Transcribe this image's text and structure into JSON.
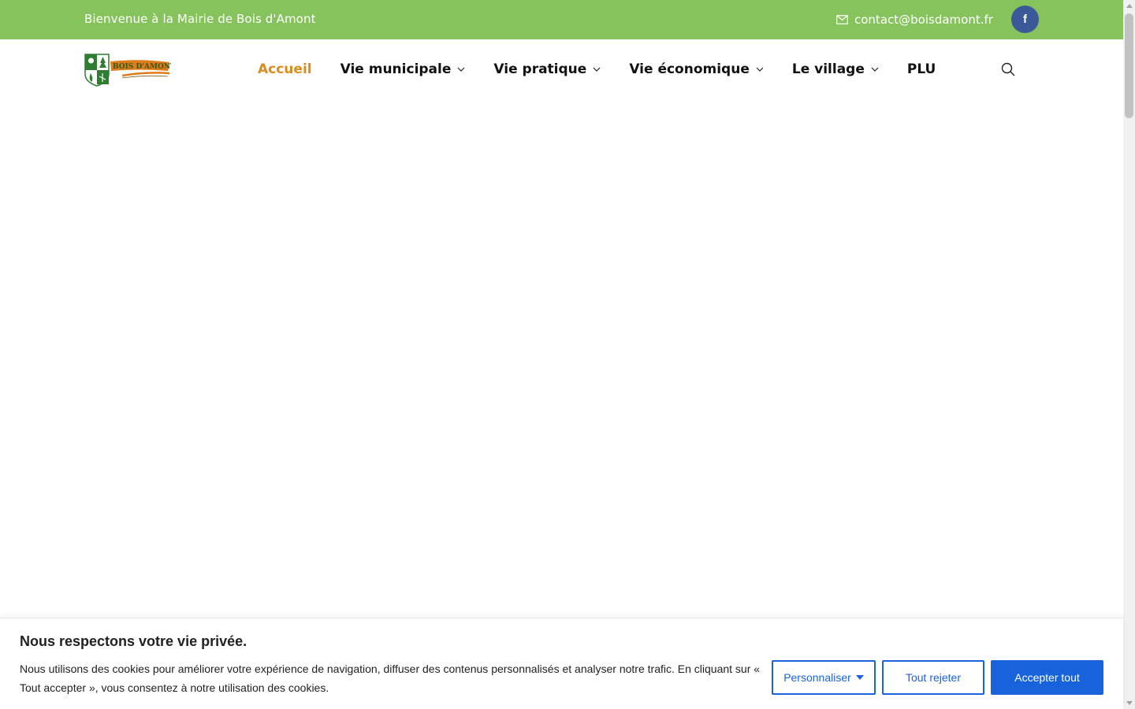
{
  "topbar": {
    "welcome_text": "Bienvenue à la Mairie de Bois d'Amont",
    "email": "contact@boisdamont.fr",
    "facebook_label": "f",
    "background_color": "#86c35c"
  },
  "header": {
    "logo_text": "Bois d'Amont",
    "nav": [
      {
        "label": "Accueil",
        "active": true,
        "has_dropdown": false
      },
      {
        "label": "Vie municipale",
        "active": false,
        "has_dropdown": true
      },
      {
        "label": "Vie pratique",
        "active": false,
        "has_dropdown": true
      },
      {
        "label": "Vie économique",
        "active": false,
        "has_dropdown": true
      },
      {
        "label": "Le village",
        "active": false,
        "has_dropdown": true
      },
      {
        "label": "PLU",
        "active": false,
        "has_dropdown": false
      }
    ],
    "active_color": "#d98d1e",
    "search_icon": "search-icon"
  },
  "cookie_banner": {
    "title": "Nous respectons votre vie privée.",
    "text": "Nous utilisons des cookies pour améliorer votre expérience de navigation, diffuser des contenus personnalisés et analyser notre trafic. En cliquant sur « Tout accepter », vous consentez à notre utilisation des cookies.",
    "customize_label": "Personnaliser",
    "reject_label": "Tout rejeter",
    "accept_label": "Accepter tout",
    "button_color": "#1863dc"
  }
}
